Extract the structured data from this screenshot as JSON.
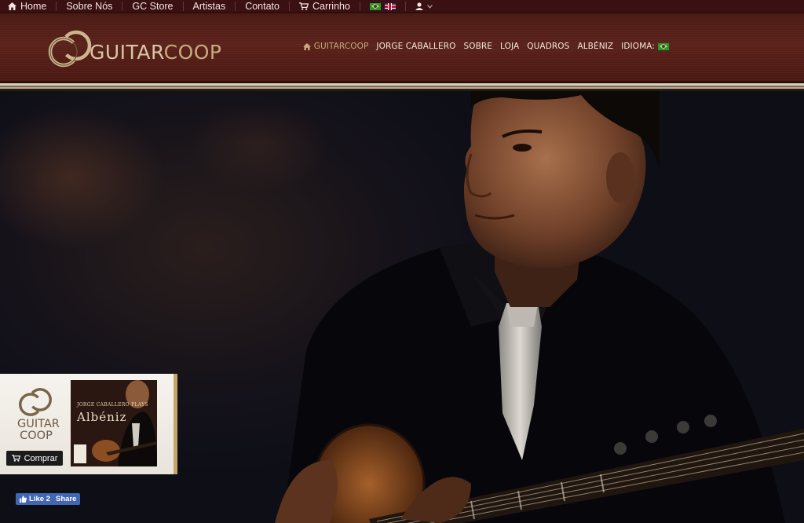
{
  "topbar": {
    "home": "Home",
    "about": "Sobre Nós",
    "store": "GC Store",
    "artists": "Artistas",
    "contact": "Contato",
    "cart": "Carrinho"
  },
  "brand": {
    "logo_text_a": "GUITAR",
    "logo_text_b": "COOP"
  },
  "nav": {
    "items": [
      "GUITARCOOP",
      "JORGE CABALLERO",
      "SOBRE",
      "LOJA",
      "QUADROS",
      "ALBÉNIZ"
    ],
    "language_label": "IDIOMA:"
  },
  "promo": {
    "logo_line1": "GUITAR",
    "logo_line2": "COOP",
    "buy_label": "Comprar",
    "album_artist": "JORGE CABALLERO",
    "album_plays": "PLAYS",
    "album_title": "Albéniz"
  },
  "facebook": {
    "like_label": "Like 2",
    "share_label": "Share"
  },
  "colors": {
    "accent": "#c9a97e",
    "header": "#4a1a14",
    "topbar": "#3a1010"
  }
}
